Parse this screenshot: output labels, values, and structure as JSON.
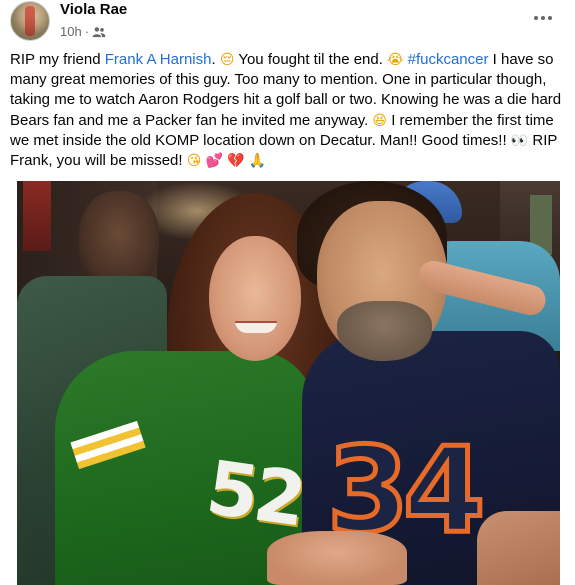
{
  "post": {
    "author": "Viola Rae",
    "timestamp": "10h",
    "separator": "·",
    "audience_icon": "friends-icon",
    "more_icon": "more-horizontal-icon"
  },
  "text": {
    "part1": "RIP my friend ",
    "mention": "Frank A Harnish",
    "part2": ". ",
    "emoji1": "😔",
    "part3": " You fought til the end. ",
    "emoji2": "😭",
    "part4": " ",
    "hashtag": "#fuckcancer",
    "part5": " I have so many great memories of this guy. Too many to mention. One in particular though, taking me to watch Aaron Rodgers hit a golf ball or two. Knowing he was a die hard Bears fan and me a Packer fan he invited me anyway. ",
    "emoji3": "😆",
    "part6": " I remember the first time we met inside the old KOMP location down on Decatur. Man!! Good times!! ",
    "emoji4": "👀",
    "part7": " RIP Frank, you will be missed! ",
    "emoji5": "😘",
    "emoji6": "💕",
    "emoji7": "💔",
    "emoji8": "🙏"
  },
  "photo": {
    "jersey_left_number": "52",
    "jersey_right_number": "34"
  }
}
